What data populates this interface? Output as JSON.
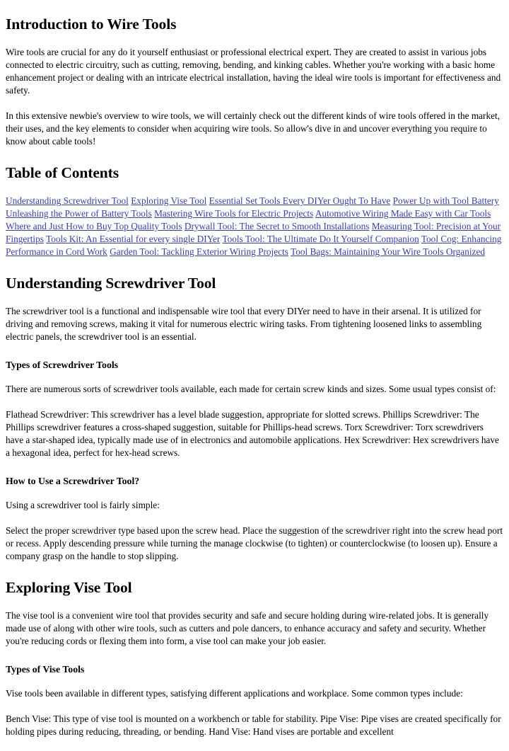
{
  "document": {
    "title": "Introduction to Wire Tools",
    "link_color": "#3b3bc4",
    "text_color": "#000000",
    "background_color": "#ffffff"
  },
  "intro": {
    "heading": "Introduction to Wire Tools",
    "paragraph_1": "Wire tools are crucial for any do it yourself enthusiast or professional electrical expert. They are created to assist in various jobs connected to electric circuitry, such as cutting, removing, bending, and kinking cables. Whether you're working with a basic home enhancement project or dealing with an intricate electrical installation, having the ideal wire tools is important for effectiveness and safety.",
    "paragraph_2": "In this extensive newbie's overview to wire tools, we will certainly check out the different kinds of wire tools offered in the market, their uses, and the key elements to consider when acquiring wire tools. So allow's dive in and uncover everything you require to know about cable tools!"
  },
  "toc": {
    "heading": "Table of Contents",
    "links": [
      "Understanding Screwdriver Tool",
      "Exploring Vise Tool",
      "Essential Set Tools Every DIYer Ought To Have",
      "Power Up with Tool Battery",
      "Unleashing the Power of Battery Tools",
      "Mastering Wire Tools for Electric Projects",
      "Automotive Wiring Made Easy with Car Tools",
      "Where and Just How to Buy Top Quality Tools",
      "Drywall Tool: The Secret to Smooth Installations",
      "Measuring Tool: Precision at Your Fingertips",
      "Tools Kit: An Essential for every single DIYer",
      "Tools Tool: The Ultimate Do It Yourself Companion",
      "Tool Cog: Enhancing Performance in Cord Work",
      "Garden Tool: Tackling Exterior Wiring Projects",
      "Tool Bags: Maintaining Your Wire Tools Organized"
    ]
  },
  "screwdriver_section": {
    "heading": "Understanding Screwdriver Tool",
    "paragraph_1": "The screwdriver tool is a functional and indispensable wire tool that every DIYer need to have in their arsenal. It is utilized for driving and removing screws, making it vital for numerous electric wiring tasks. From tightening loosened links to assembling electric panels, the screwdriver tool is an essential.",
    "types_heading": "Types of Screwdriver Tools",
    "types_paragraph_1": "There are numerous sorts of screwdriver tools available, each made for certain screw kinds and sizes. Some usual types consist of:",
    "types_paragraph_2": "Flathead Screwdriver: This screwdriver has a level blade suggestion, appropriate for slotted screws. Phillips Screwdriver: The Phillips screwdriver features a cross-shaped suggestion, suitable for Phillips-head screws. Torx Screwdriver: Torx screwdrivers have a star-shaped idea, typically made use of in electronics and automobile applications. Hex Screwdriver: Hex screwdrivers have a hexagonal idea, perfect for hex-head screws.",
    "howto_heading": "How to Use a Screwdriver Tool?",
    "howto_paragraph_1": "Using a screwdriver tool is fairly simple:",
    "howto_paragraph_2": "Select the proper screwdriver type based upon the screw head. Place the suggestion of the screwdriver right into the screw head port or recess. Apply descending pressure while turning the manage clockwise (to tighten) or counterclockwise (to loosen up). Ensure a company grasp on the handle to stop slipping."
  },
  "vise_section": {
    "heading": "Exploring Vise Tool",
    "paragraph_1": "The vise tool is a convenient wire tool that provides security and safe and secure holding during wire-related jobs. It is generally made use of along with other wire tools, such as cutters and pole dancers, to enhance accuracy and safety and security. Whether you're reducing cords or flexing them into form, a vise tool can make your job easier.",
    "types_heading": "Types of Vise Tools",
    "types_paragraph_1": "Vise tools been available in different types, satisfying different applications and workplace. Some common types include:",
    "types_paragraph_2": "Bench Vise: This type of vise tool is mounted on a workbench or table for stability. Pipe Vise: Pipe vises are created specifically for holding pipes during reducing, threading, or bending. Hand Vise: Hand vises are portable and excellent"
  }
}
